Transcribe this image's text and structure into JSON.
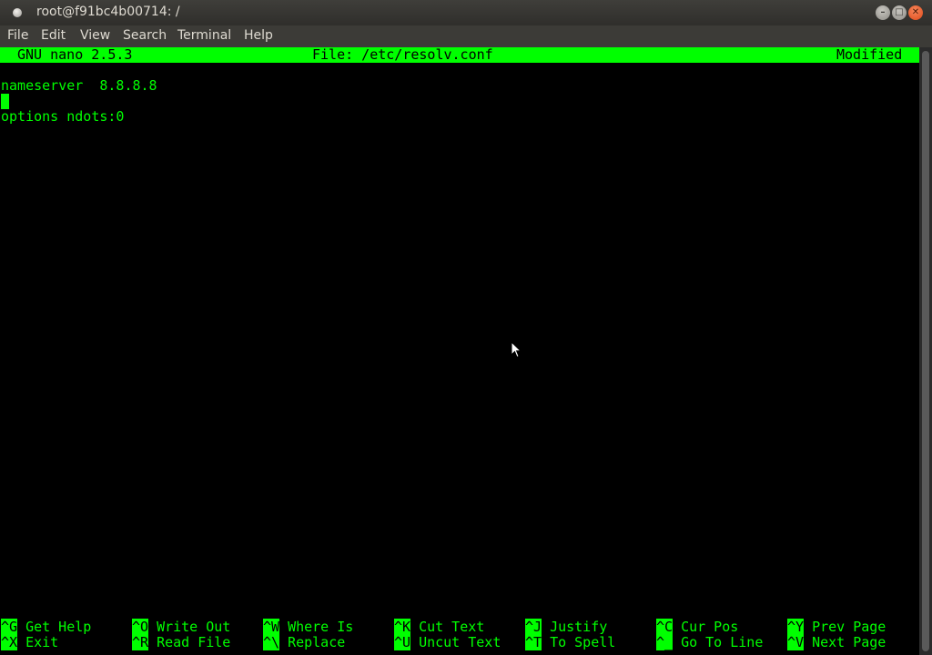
{
  "window": {
    "title": "root@f91bc4b00714: /",
    "buttons": [
      "minimize",
      "maximize",
      "close"
    ],
    "close_glyph": "✕",
    "max_glyph": "□",
    "min_glyph": "–"
  },
  "menubar": {
    "items": [
      "File",
      "Edit",
      "View",
      "Search",
      "Terminal",
      "Help"
    ]
  },
  "nano": {
    "version": "GNU nano 2.5.3",
    "file": "File: /etc/resolv.conf",
    "status": "Modified",
    "lines": [
      "nameserver  8.8.8.8",
      "",
      "options ndots:0"
    ],
    "shortcuts": [
      {
        "key": "^G",
        "label": "Get Help"
      },
      {
        "key": "^O",
        "label": "Write Out"
      },
      {
        "key": "^W",
        "label": "Where Is"
      },
      {
        "key": "^K",
        "label": "Cut Text"
      },
      {
        "key": "^J",
        "label": "Justify"
      },
      {
        "key": "^C",
        "label": "Cur Pos"
      },
      {
        "key": "^Y",
        "label": "Prev Page"
      },
      {
        "key": "^X",
        "label": "Exit"
      },
      {
        "key": "^R",
        "label": "Read File"
      },
      {
        "key": "^\\",
        "label": "Replace"
      },
      {
        "key": "^U",
        "label": "Uncut Text"
      },
      {
        "key": "^T",
        "label": "To Spell"
      },
      {
        "key": "^_",
        "label": "Go To Line"
      },
      {
        "key": "^V",
        "label": "Next Page"
      }
    ]
  },
  "colors": {
    "terminal_fg": "#00ff00",
    "terminal_bg": "#000000",
    "titlebar_bg": "#3c3b37",
    "close_button": "#e95420"
  }
}
